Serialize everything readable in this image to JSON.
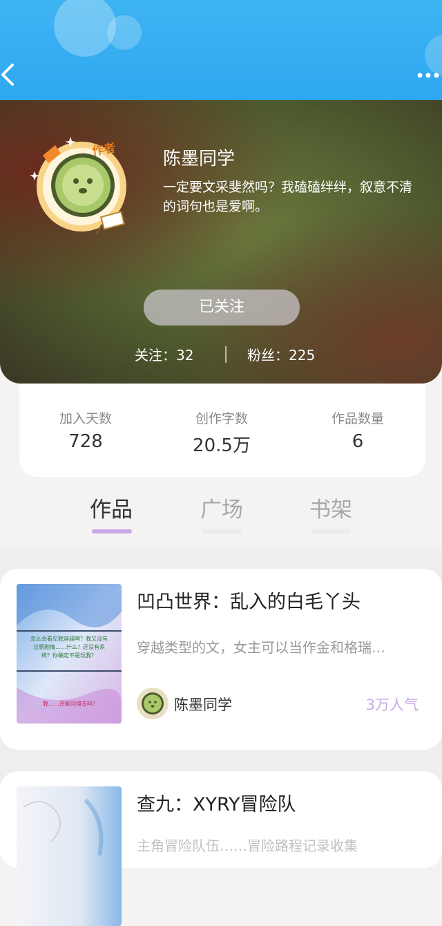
{
  "profile": {
    "name": "陈墨同学",
    "bio": "一定要文采斐然吗？我磕磕绊绊，叙意不清的词句也是爱啊。",
    "badge": "作者",
    "follow_button": "已关注",
    "following_text": "关注：32",
    "fans_text": "粉丝：225"
  },
  "stats": [
    {
      "label": "加入天数",
      "value": "728"
    },
    {
      "label": "创作字数",
      "value": "20.5万"
    },
    {
      "label": "作品数量",
      "value": "6"
    }
  ],
  "tabs": [
    {
      "label": "作品"
    },
    {
      "label": "广场"
    },
    {
      "label": "书架"
    }
  ],
  "books": [
    {
      "title": "凹凸世界：乱入的白毛丫头",
      "desc": "穿越类型的文，女主可以当作金和格瑞…",
      "author": "陈墨同学",
      "popularity": "3万人气",
      "cover_text": "怎么会看见我穿越啊？我又没有过原剧情……什么？还没有系统？你确定不是玩我？",
      "cover_text2": "我……还能回得去吗？"
    },
    {
      "title": "查九：XYRY冒险队",
      "desc": "主角冒险队伍……冒险路程记录收集"
    }
  ],
  "colors": {
    "accent": "#c9a8e8",
    "topbar": "#2ba6f0"
  }
}
